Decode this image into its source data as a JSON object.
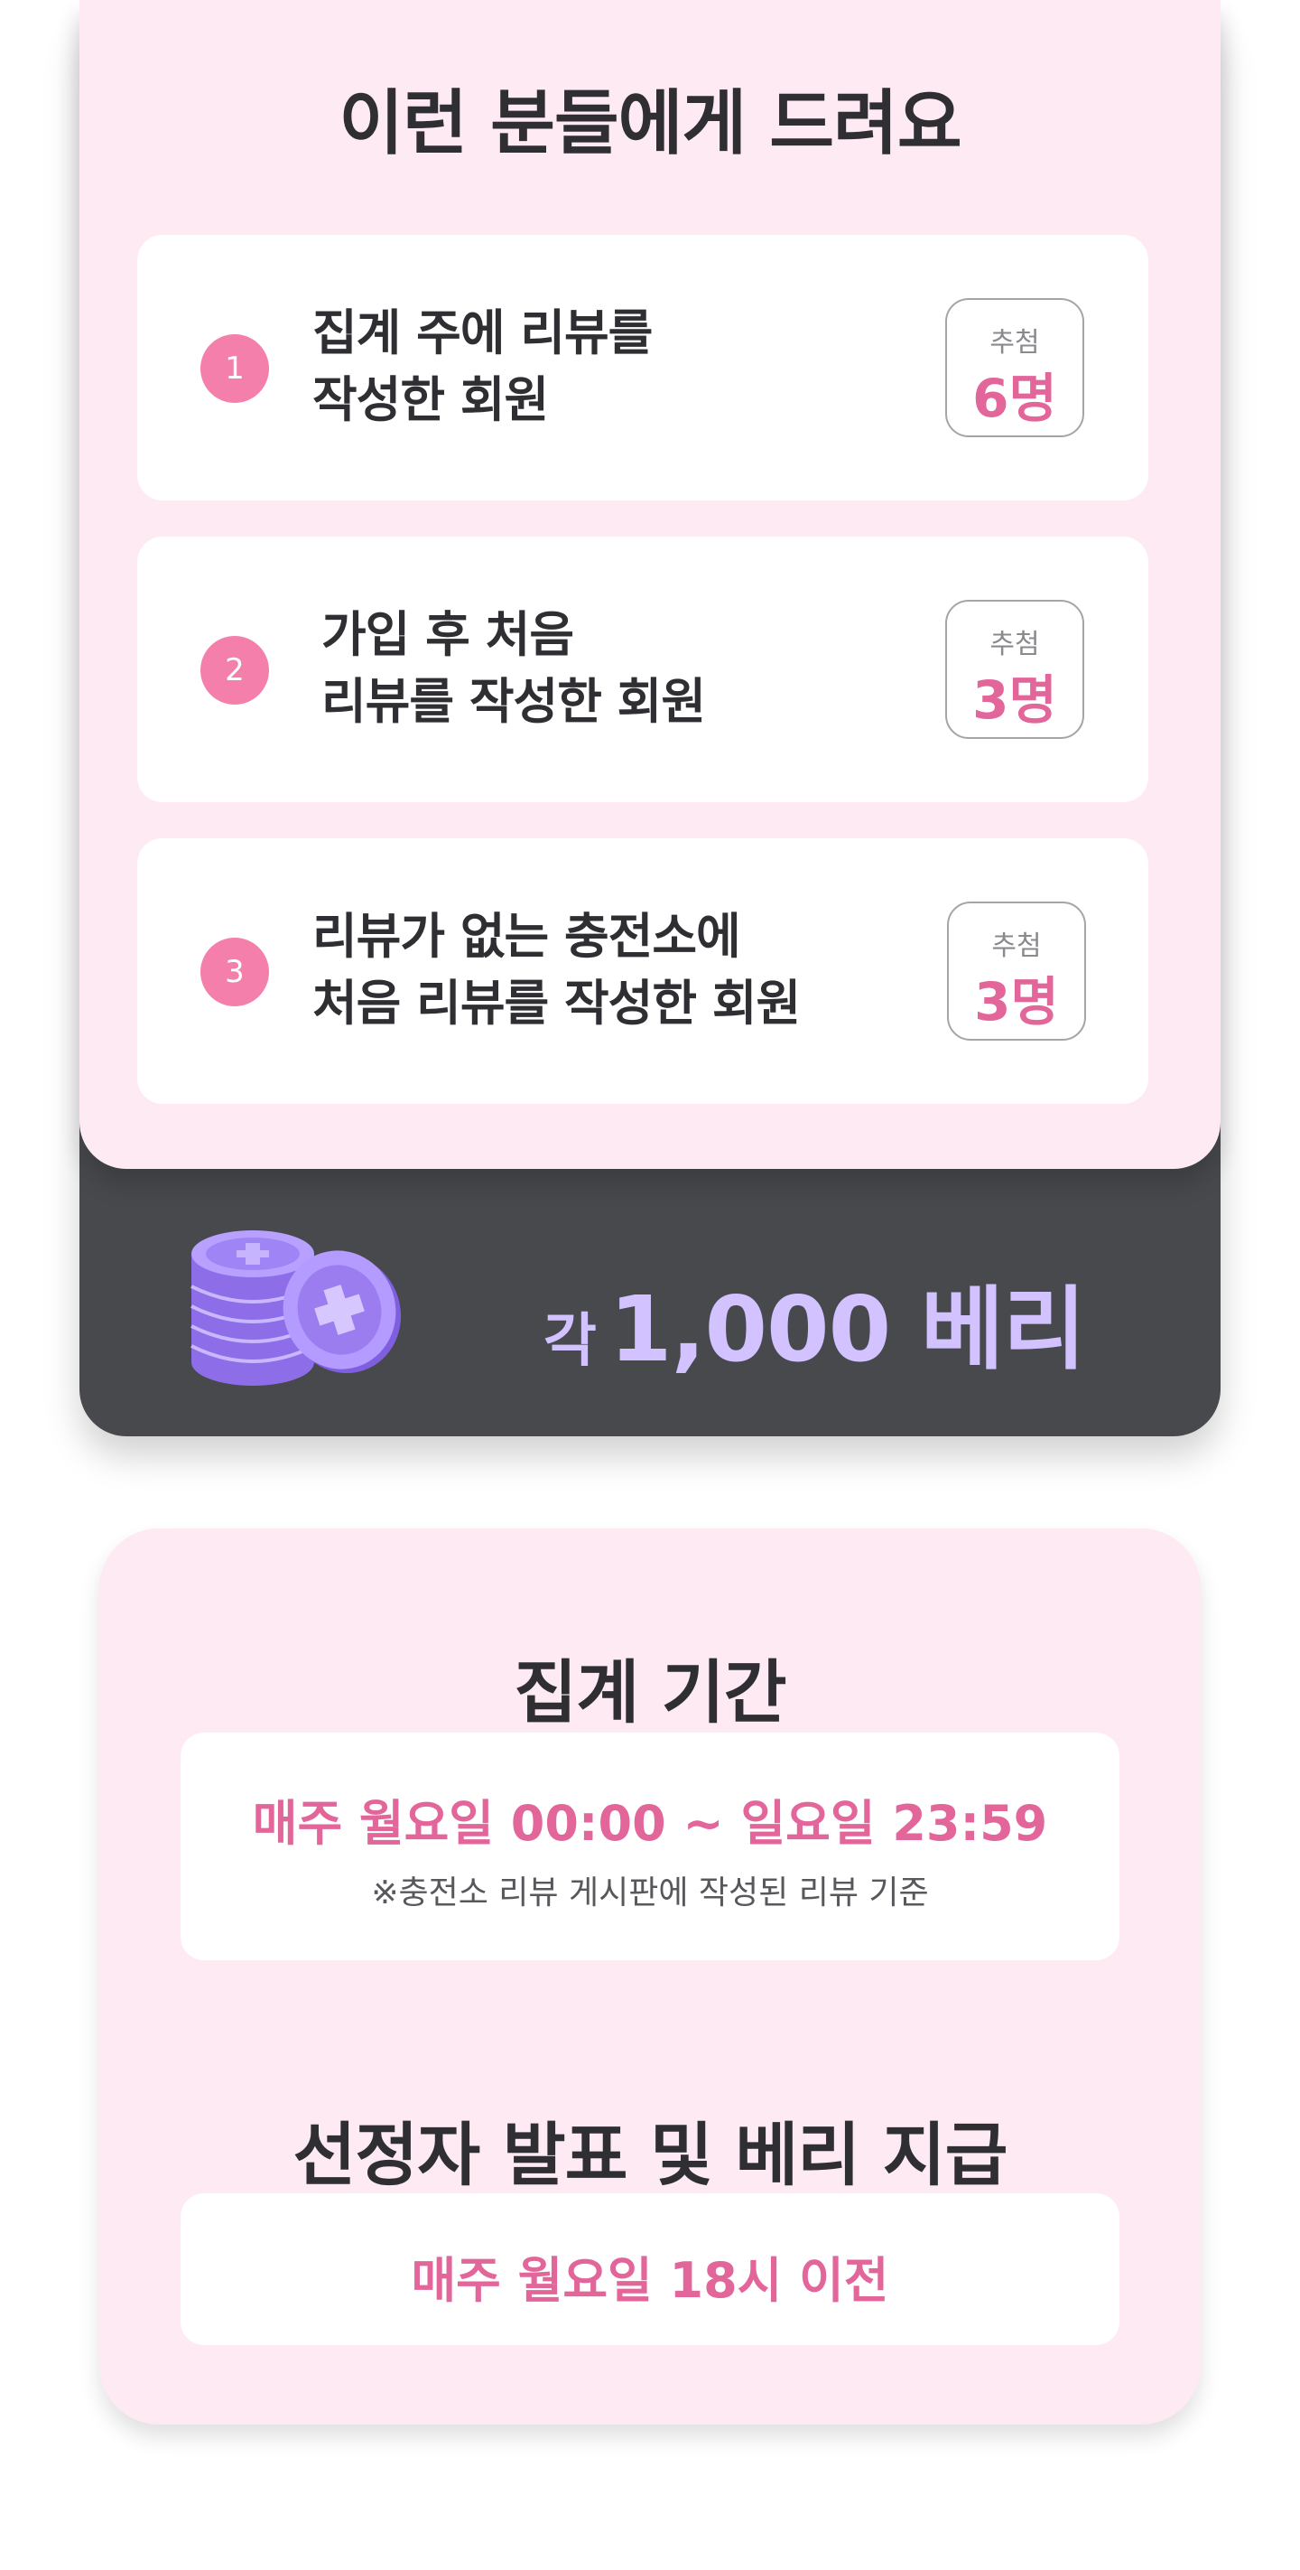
{
  "audience": {
    "title": "이런 분들에게 드려요",
    "items": [
      {
        "number": "1",
        "line1": "집계 주에 리뷰를",
        "line2": "작성한 회원",
        "prize_label": "추첨",
        "prize_count": "6명"
      },
      {
        "number": "2",
        "line1": "가입 후 처음",
        "line2": "리뷰를 작성한 회원",
        "prize_label": "추첨",
        "prize_count": "3명"
      },
      {
        "number": "3",
        "line1": "리뷰가 없는 충전소에",
        "line2": "처음 리뷰를 작성한 회원",
        "prize_label": "추첨",
        "prize_count": "3명"
      }
    ]
  },
  "reward": {
    "prefix": "각",
    "amount": "1,000 베리",
    "icon": "coin-stack-icon"
  },
  "period": {
    "title": "집계 기간",
    "schedule": "매주 월요일 00:00 ~ 일요일 23:59",
    "note": "※충전소 리뷰 게시판에 작성된 리뷰 기준"
  },
  "announcement": {
    "title": "선정자 발표 및 베리 지급",
    "schedule": "매주 월요일 18시 이전"
  },
  "colors": {
    "pink_bg": "#fdeaf2",
    "accent_pink": "#e2669a",
    "badge_pink": "#f47fab",
    "dark_panel": "#47494d",
    "reward_lavender": "#d2c2ff",
    "coin_purple": "#9b7df0"
  }
}
